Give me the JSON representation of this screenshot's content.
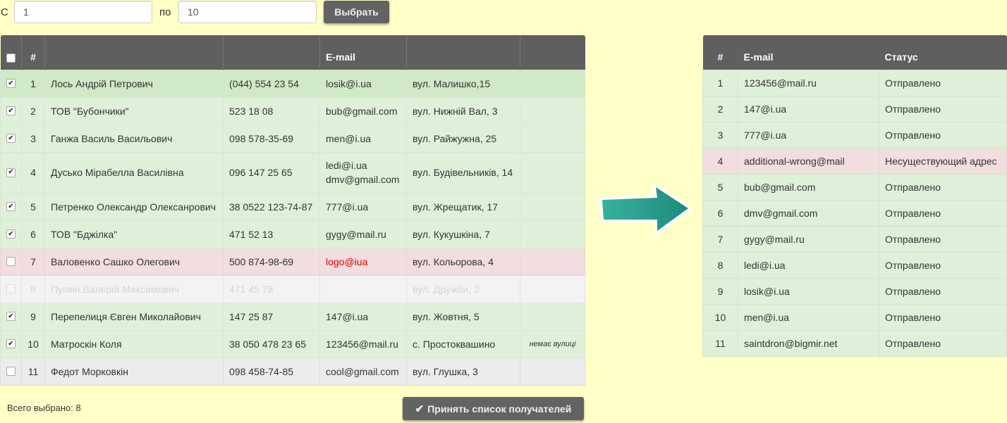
{
  "range": {
    "from_label": "С",
    "from_value": "1",
    "to_label": "по",
    "to_value": "10",
    "select_button": "Выбрать"
  },
  "left_table": {
    "headers": [
      "",
      "#",
      "",
      "",
      "E-mail",
      "",
      ""
    ],
    "rows": [
      {
        "checked": true,
        "state": "ok first",
        "num": "1",
        "name": "Лось Андрій Петрович",
        "phone": "(044) 554 23 54",
        "email": "losik@i.ua",
        "email2": "",
        "address": "вул. Малишко,15",
        "note": ""
      },
      {
        "checked": true,
        "state": "ok",
        "num": "2",
        "name": "ТОВ \"Бубончики\"",
        "phone": "523 18 08",
        "email": "bub@gmail.com",
        "email2": "",
        "address": "вул. Нижній Вал, 3",
        "note": ""
      },
      {
        "checked": true,
        "state": "ok",
        "num": "3",
        "name": "Ганжа Василь Васильович",
        "phone": "098 578-35-69",
        "email": "men@i.ua",
        "email2": "",
        "address": "вул. Райжужна, 25",
        "note": ""
      },
      {
        "checked": true,
        "state": "ok tall",
        "num": "4",
        "name": "Дусько Мірабелла Василівна",
        "phone": "096 147 25 65",
        "email": "ledi@i.ua",
        "email2": "dmv@gmail.com",
        "address": "вул. Будівельників, 14",
        "note": ""
      },
      {
        "checked": true,
        "state": "ok",
        "num": "5",
        "name": "Петренко Олександр Олексанрович",
        "phone": "38 0522 123-74-87",
        "email": "777@i.ua",
        "email2": "",
        "address": "вул. Жрещатик, 17",
        "note": ""
      },
      {
        "checked": true,
        "state": "ok",
        "num": "6",
        "name": "ТОВ \"Бджілка\"",
        "phone": "471 52 13",
        "email": "gygy@mail.ru",
        "email2": "",
        "address": "вул. Кукушкіна, 7",
        "note": ""
      },
      {
        "checked": false,
        "state": "err",
        "num": "7",
        "name": "Валовенко Сашко Олегович",
        "phone": "500 874-98-69",
        "email": "logo@iua",
        "email2": "",
        "address": "вул. Кольорова, 4",
        "note": ""
      },
      {
        "checked": false,
        "state": "dis",
        "num": "8",
        "name": "Пупкін Валерій Максимович",
        "phone": "471 45 78",
        "email": "",
        "email2": "",
        "address": "вул. Дружби, 2",
        "note": ""
      },
      {
        "checked": true,
        "state": "ok",
        "num": "9",
        "name": "Перепелиця Євген Миколайович",
        "phone": "147 25 87",
        "email": "147@i.ua",
        "email2": "",
        "address": "вул. Жовтня, 5",
        "note": ""
      },
      {
        "checked": true,
        "state": "ok",
        "num": "10",
        "name": "Матроскін Коля",
        "phone": "38 050 478 23 65",
        "email": "123456@mail.ru",
        "email2": "",
        "address": "с. Простоквашино",
        "note": "немає вулиці"
      },
      {
        "checked": false,
        "state": "off",
        "num": "11",
        "name": "Федот Морковкін",
        "phone": "098 458-74-85",
        "email": "cool@gmail.com",
        "email2": "",
        "address": "вул. Глушка, 3",
        "note": ""
      }
    ]
  },
  "footer": {
    "total_label": "Всего выбрано: 8",
    "accept_button": "Принять список получателей"
  },
  "right_table": {
    "headers": [
      "#",
      "E-mail",
      "Статус"
    ],
    "rows": [
      {
        "num": "1",
        "email": "123456@mail.ru",
        "status": "Отправлено",
        "state": "ok"
      },
      {
        "num": "2",
        "email": "147@i.ua",
        "status": "Отправлено",
        "state": "ok"
      },
      {
        "num": "3",
        "email": "777@i.ua",
        "status": "Отправлено",
        "state": "ok"
      },
      {
        "num": "4",
        "email": "additional-wrong@mail",
        "status": "Несуществующий адрес",
        "state": "err"
      },
      {
        "num": "5",
        "email": "bub@gmail.com",
        "status": "Отправлено",
        "state": "ok"
      },
      {
        "num": "6",
        "email": "dmv@gmail.com",
        "status": "Отправлено",
        "state": "ok"
      },
      {
        "num": "7",
        "email": "gygy@mail.ru",
        "status": "Отправлено",
        "state": "ok"
      },
      {
        "num": "8",
        "email": "ledi@i.ua",
        "status": "Отправлено",
        "state": "ok"
      },
      {
        "num": "9",
        "email": "losik@i.ua",
        "status": "Отправлено",
        "state": "ok"
      },
      {
        "num": "10",
        "email": "men@i.ua",
        "status": "Отправлено",
        "state": "ok"
      },
      {
        "num": "11",
        "email": "saintdron@bigmir.net",
        "status": "Отправлено",
        "state": "ok"
      }
    ]
  },
  "colors": {
    "header_bg": "#5f5f5f",
    "ok_row": "#dff0d8",
    "error_row": "#f2dede",
    "page_bg": "#ffffc7",
    "arrow": "#2a9d8f",
    "error_text": "#e00000"
  },
  "icons": {
    "accept": "check-icon",
    "arrow": "right-arrow-icon"
  }
}
